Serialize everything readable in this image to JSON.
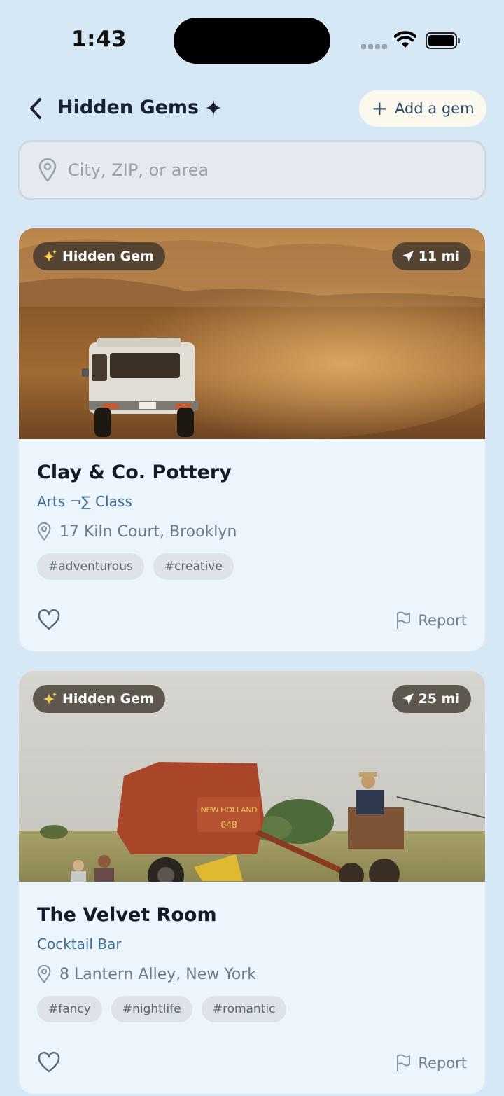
{
  "status": {
    "time": "1:43"
  },
  "header": {
    "back_icon": "chevron-left-icon",
    "title": "Hidden Gems",
    "title_icon": "sparkle-icon",
    "add_label": "Add a gem"
  },
  "search": {
    "placeholder": "City, ZIP, or area",
    "value": ""
  },
  "cards": [
    {
      "badge": "Hidden Gem",
      "distance": "11 mi",
      "name": "Clay & Co. Pottery",
      "category": "Arts ¬∑ Class",
      "address": "17 Kiln Court, Brooklyn",
      "tags": [
        "#adventurous",
        "#creative"
      ],
      "report_label": "Report",
      "image": "desert-van-photo"
    },
    {
      "badge": "Hidden Gem",
      "distance": "25 mi",
      "name": "The Velvet Room",
      "category": "Cocktail Bar",
      "address": "8 Lantern Alley, New York",
      "tags": [
        "#fancy",
        "#nightlife",
        "#romantic"
      ],
      "report_label": "Report",
      "image": "farm-baler-photo"
    }
  ],
  "colors": {
    "background": "#d6e7f6",
    "card": "#ecf4fc",
    "category": "#3d6f93",
    "badge": "#3c342c"
  }
}
